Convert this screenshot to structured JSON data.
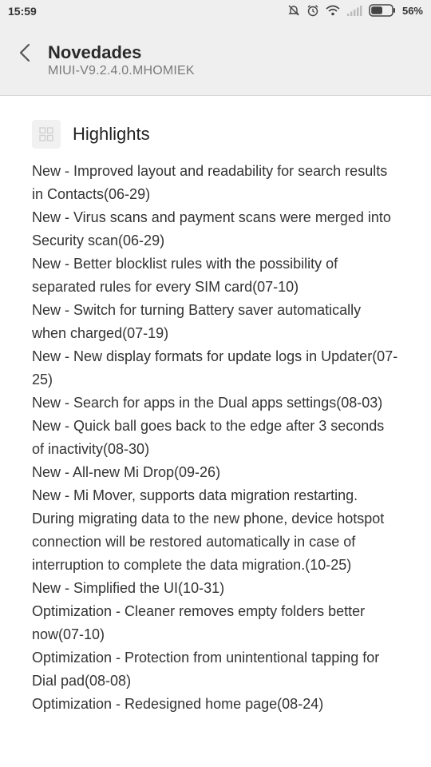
{
  "status_bar": {
    "time": "15:59",
    "battery_percent": "56%",
    "battery_level": 0.56,
    "icons": [
      "notifications-off-icon",
      "alarm-icon",
      "wifi-icon",
      "signal-icon",
      "battery-icon"
    ]
  },
  "header": {
    "title": "Novedades",
    "subtitle": "MIUI-V9.2.4.0.MHOMIEK",
    "back_icon": "chevron-left-icon"
  },
  "section": {
    "title": "Highlights",
    "icon": "grid-icon"
  },
  "notes": [
    "New - Improved layout and readability for search results in Contacts(06-29)",
    "New - Virus scans and payment scans were merged into Security scan(06-29)",
    "New - Better blocklist rules with the possibility of separated rules for every SIM card(07-10)",
    "New - Switch for turning Battery saver automatically when charged(07-19)",
    "New - New display formats for update logs in Updater(07-25)",
    "New - Search for apps in the Dual apps settings(08-03)",
    "New - Quick ball goes back to the edge after 3 seconds of inactivity(08-30)",
    "New - All-new Mi Drop(09-26)",
    "New - Mi Mover, supports data migration restarting. During migrating data to the new phone, device hotspot connection will be restored automatically in case of interruption to complete the data migration.(10-25)",
    "New - Simplified the UI(10-31)",
    "Optimization - Cleaner removes empty folders better now(07-10)",
    "Optimization - Protection from unintentional tapping for Dial pad(08-08)",
    "Optimization - Redesigned home page(08-24)"
  ]
}
